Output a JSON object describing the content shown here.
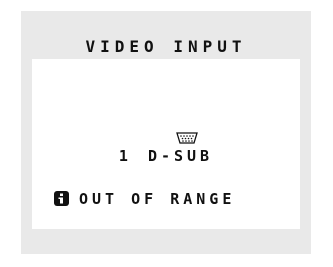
{
  "osd": {
    "title": "VIDEO INPUT",
    "input": {
      "number": "1",
      "name": "D-SUB",
      "icon": "vga-connector-icon"
    },
    "status": {
      "icon": "info-icon",
      "message": "OUT OF RANGE"
    }
  },
  "colors": {
    "panel_background": "#e9e9e9",
    "content_background": "#ffffff",
    "text": "#111111"
  }
}
